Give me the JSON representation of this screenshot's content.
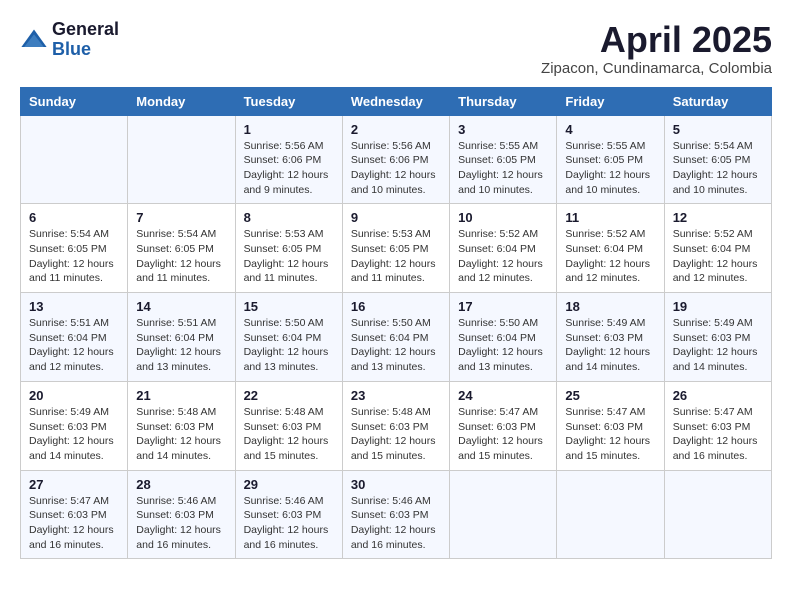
{
  "header": {
    "logo_general": "General",
    "logo_blue": "Blue",
    "month_title": "April 2025",
    "location": "Zipacon, Cundinamarca, Colombia"
  },
  "weekdays": [
    "Sunday",
    "Monday",
    "Tuesday",
    "Wednesday",
    "Thursday",
    "Friday",
    "Saturday"
  ],
  "weeks": [
    [
      {
        "day": "",
        "info": ""
      },
      {
        "day": "",
        "info": ""
      },
      {
        "day": "1",
        "info": "Sunrise: 5:56 AM\nSunset: 6:06 PM\nDaylight: 12 hours and 9 minutes."
      },
      {
        "day": "2",
        "info": "Sunrise: 5:56 AM\nSunset: 6:06 PM\nDaylight: 12 hours and 10 minutes."
      },
      {
        "day": "3",
        "info": "Sunrise: 5:55 AM\nSunset: 6:05 PM\nDaylight: 12 hours and 10 minutes."
      },
      {
        "day": "4",
        "info": "Sunrise: 5:55 AM\nSunset: 6:05 PM\nDaylight: 12 hours and 10 minutes."
      },
      {
        "day": "5",
        "info": "Sunrise: 5:54 AM\nSunset: 6:05 PM\nDaylight: 12 hours and 10 minutes."
      }
    ],
    [
      {
        "day": "6",
        "info": "Sunrise: 5:54 AM\nSunset: 6:05 PM\nDaylight: 12 hours and 11 minutes."
      },
      {
        "day": "7",
        "info": "Sunrise: 5:54 AM\nSunset: 6:05 PM\nDaylight: 12 hours and 11 minutes."
      },
      {
        "day": "8",
        "info": "Sunrise: 5:53 AM\nSunset: 6:05 PM\nDaylight: 12 hours and 11 minutes."
      },
      {
        "day": "9",
        "info": "Sunrise: 5:53 AM\nSunset: 6:05 PM\nDaylight: 12 hours and 11 minutes."
      },
      {
        "day": "10",
        "info": "Sunrise: 5:52 AM\nSunset: 6:04 PM\nDaylight: 12 hours and 12 minutes."
      },
      {
        "day": "11",
        "info": "Sunrise: 5:52 AM\nSunset: 6:04 PM\nDaylight: 12 hours and 12 minutes."
      },
      {
        "day": "12",
        "info": "Sunrise: 5:52 AM\nSunset: 6:04 PM\nDaylight: 12 hours and 12 minutes."
      }
    ],
    [
      {
        "day": "13",
        "info": "Sunrise: 5:51 AM\nSunset: 6:04 PM\nDaylight: 12 hours and 12 minutes."
      },
      {
        "day": "14",
        "info": "Sunrise: 5:51 AM\nSunset: 6:04 PM\nDaylight: 12 hours and 13 minutes."
      },
      {
        "day": "15",
        "info": "Sunrise: 5:50 AM\nSunset: 6:04 PM\nDaylight: 12 hours and 13 minutes."
      },
      {
        "day": "16",
        "info": "Sunrise: 5:50 AM\nSunset: 6:04 PM\nDaylight: 12 hours and 13 minutes."
      },
      {
        "day": "17",
        "info": "Sunrise: 5:50 AM\nSunset: 6:04 PM\nDaylight: 12 hours and 13 minutes."
      },
      {
        "day": "18",
        "info": "Sunrise: 5:49 AM\nSunset: 6:03 PM\nDaylight: 12 hours and 14 minutes."
      },
      {
        "day": "19",
        "info": "Sunrise: 5:49 AM\nSunset: 6:03 PM\nDaylight: 12 hours and 14 minutes."
      }
    ],
    [
      {
        "day": "20",
        "info": "Sunrise: 5:49 AM\nSunset: 6:03 PM\nDaylight: 12 hours and 14 minutes."
      },
      {
        "day": "21",
        "info": "Sunrise: 5:48 AM\nSunset: 6:03 PM\nDaylight: 12 hours and 14 minutes."
      },
      {
        "day": "22",
        "info": "Sunrise: 5:48 AM\nSunset: 6:03 PM\nDaylight: 12 hours and 15 minutes."
      },
      {
        "day": "23",
        "info": "Sunrise: 5:48 AM\nSunset: 6:03 PM\nDaylight: 12 hours and 15 minutes."
      },
      {
        "day": "24",
        "info": "Sunrise: 5:47 AM\nSunset: 6:03 PM\nDaylight: 12 hours and 15 minutes."
      },
      {
        "day": "25",
        "info": "Sunrise: 5:47 AM\nSunset: 6:03 PM\nDaylight: 12 hours and 15 minutes."
      },
      {
        "day": "26",
        "info": "Sunrise: 5:47 AM\nSunset: 6:03 PM\nDaylight: 12 hours and 16 minutes."
      }
    ],
    [
      {
        "day": "27",
        "info": "Sunrise: 5:47 AM\nSunset: 6:03 PM\nDaylight: 12 hours and 16 minutes."
      },
      {
        "day": "28",
        "info": "Sunrise: 5:46 AM\nSunset: 6:03 PM\nDaylight: 12 hours and 16 minutes."
      },
      {
        "day": "29",
        "info": "Sunrise: 5:46 AM\nSunset: 6:03 PM\nDaylight: 12 hours and 16 minutes."
      },
      {
        "day": "30",
        "info": "Sunrise: 5:46 AM\nSunset: 6:03 PM\nDaylight: 12 hours and 16 minutes."
      },
      {
        "day": "",
        "info": ""
      },
      {
        "day": "",
        "info": ""
      },
      {
        "day": "",
        "info": ""
      }
    ]
  ]
}
